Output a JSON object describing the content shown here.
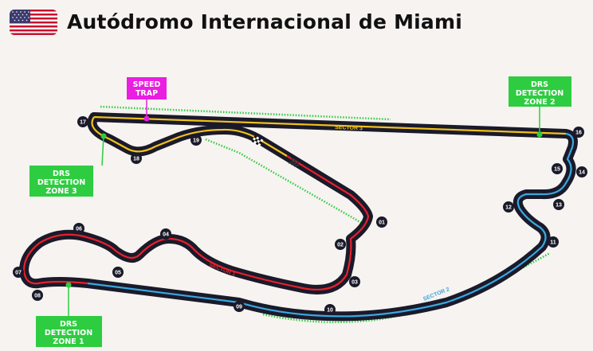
{
  "header": {
    "title": "Autódromo Internacional de Miami",
    "flag_icon": "usa-flag-icon"
  },
  "colors": {
    "track": "#1a1a2a",
    "sector1": "#e8202a",
    "sector2": "#3aa8e0",
    "sector3": "#f2c21a",
    "drs": "#2ecc40",
    "speed_trap": "#e91ee0"
  },
  "speed_trap": {
    "line1": "SPEED",
    "line2": "TRAP"
  },
  "drs_detection": [
    {
      "line1": "DRS",
      "line2": "DETECTION",
      "line3": "ZONE 1"
    },
    {
      "line1": "DRS",
      "line2": "DETECTION",
      "line3": "ZONE 2"
    },
    {
      "line1": "DRS",
      "line2": "DETECTION",
      "line3": "ZONE 3"
    }
  ],
  "sectors": {
    "s1": "SECTOR 1",
    "s2": "SECTOR 2",
    "s3": "SECTOR 3"
  },
  "turns": [
    "01",
    "02",
    "03",
    "04",
    "05",
    "06",
    "07",
    "08",
    "09",
    "10",
    "11",
    "12",
    "13",
    "14",
    "15",
    "16",
    "17",
    "18",
    "19"
  ],
  "icons": {
    "start": "checkered-flag-icon",
    "direction": "direction-chevrons-icon"
  }
}
